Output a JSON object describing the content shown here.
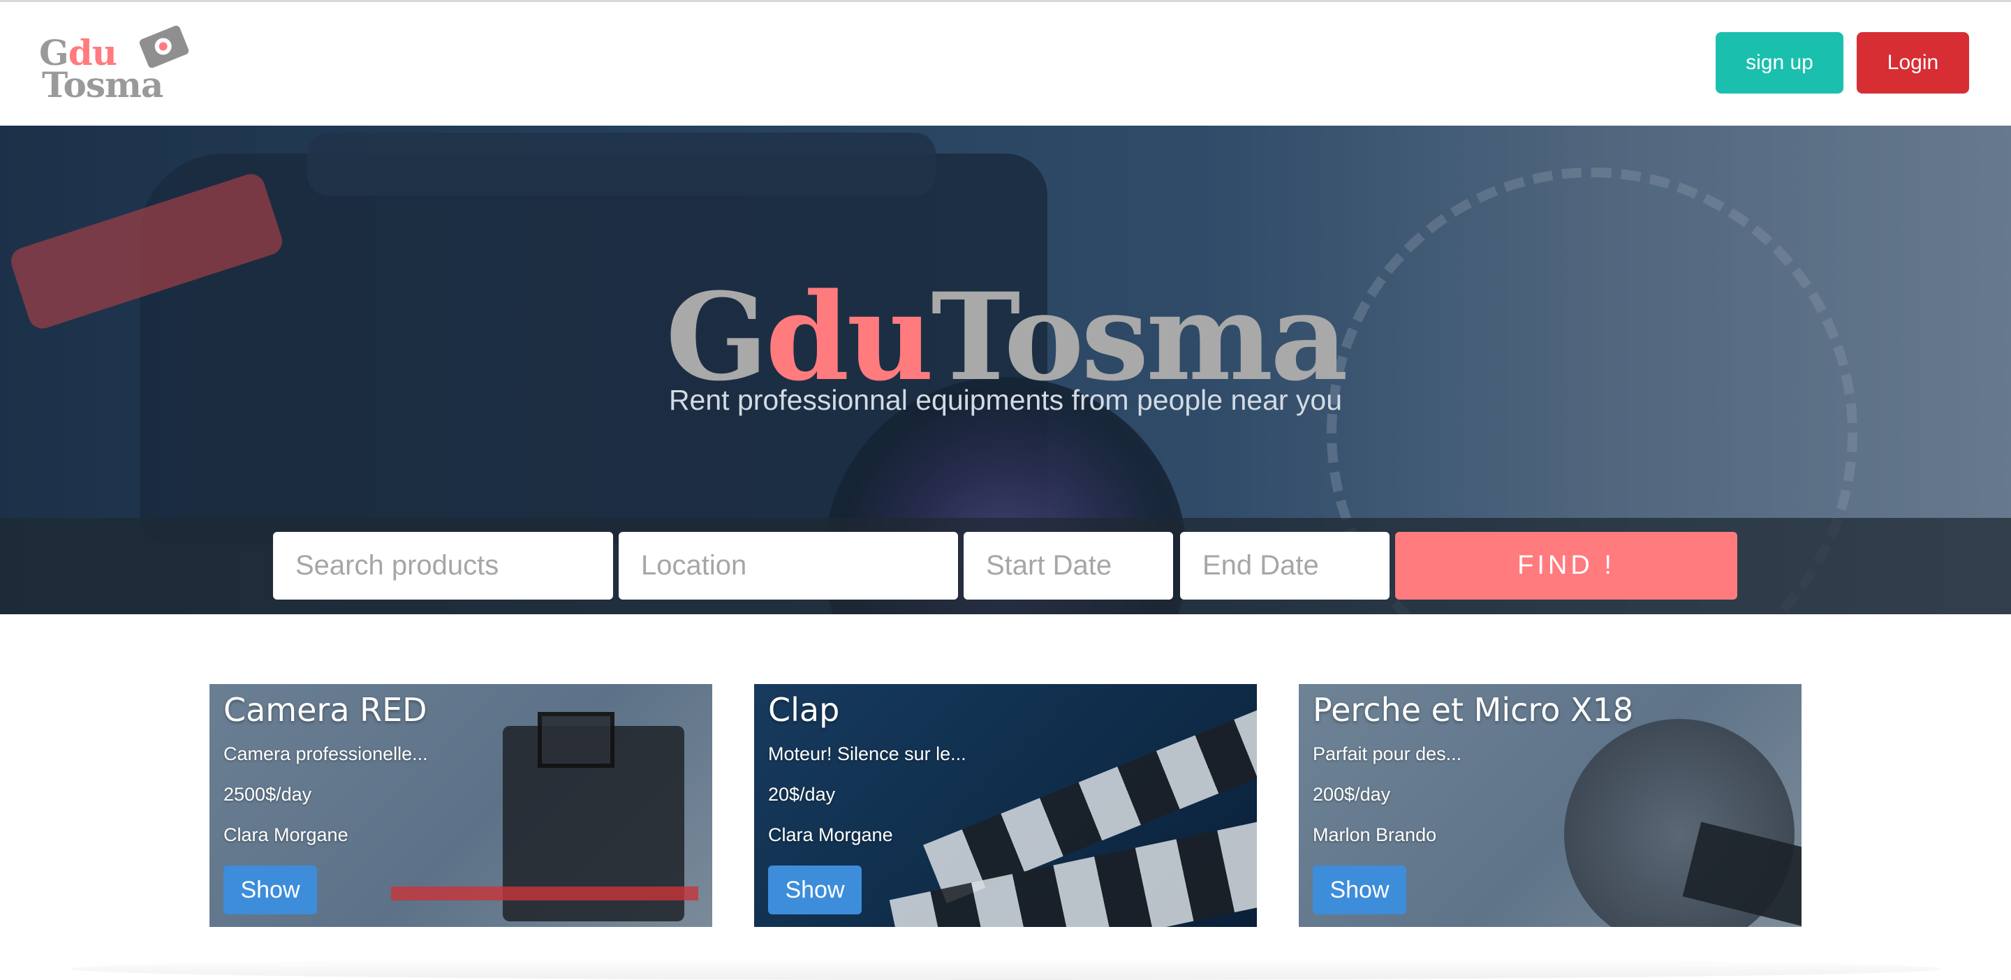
{
  "header": {
    "logo_line1_g": "G",
    "logo_line1_du": "du",
    "logo_line2": "Tosma",
    "signup_label": "sign up",
    "login_label": "Login"
  },
  "hero": {
    "title_g": "G",
    "title_du": "du",
    "title_tosma": "Tosma",
    "subtitle": "Rent professionnal equipments from people near you"
  },
  "search": {
    "product_placeholder": "Search products",
    "location_placeholder": "Location",
    "start_placeholder": "Start Date",
    "end_placeholder": "End Date",
    "find_label": "FIND !"
  },
  "products": [
    {
      "title": "Camera RED",
      "description": "Camera professionelle...",
      "price": "2500$/day",
      "owner": "Clara Morgane",
      "button": "Show"
    },
    {
      "title": "Clap",
      "description": "Moteur! Silence sur le...",
      "price": "20$/day",
      "owner": "Clara Morgane",
      "button": "Show"
    },
    {
      "title": "Perche et Micro X18",
      "description": "Parfait pour des...",
      "price": "200$/day",
      "owner": "Marlon Brando",
      "button": "Show"
    }
  ],
  "colors": {
    "brand_coral": "#ff7b7e",
    "signup_teal": "#1bbfae",
    "login_red": "#d72e34",
    "show_blue": "#3d8ddb",
    "logo_gray": "#9a9a9a"
  },
  "icons": {
    "logo_camera": "camera-icon"
  }
}
